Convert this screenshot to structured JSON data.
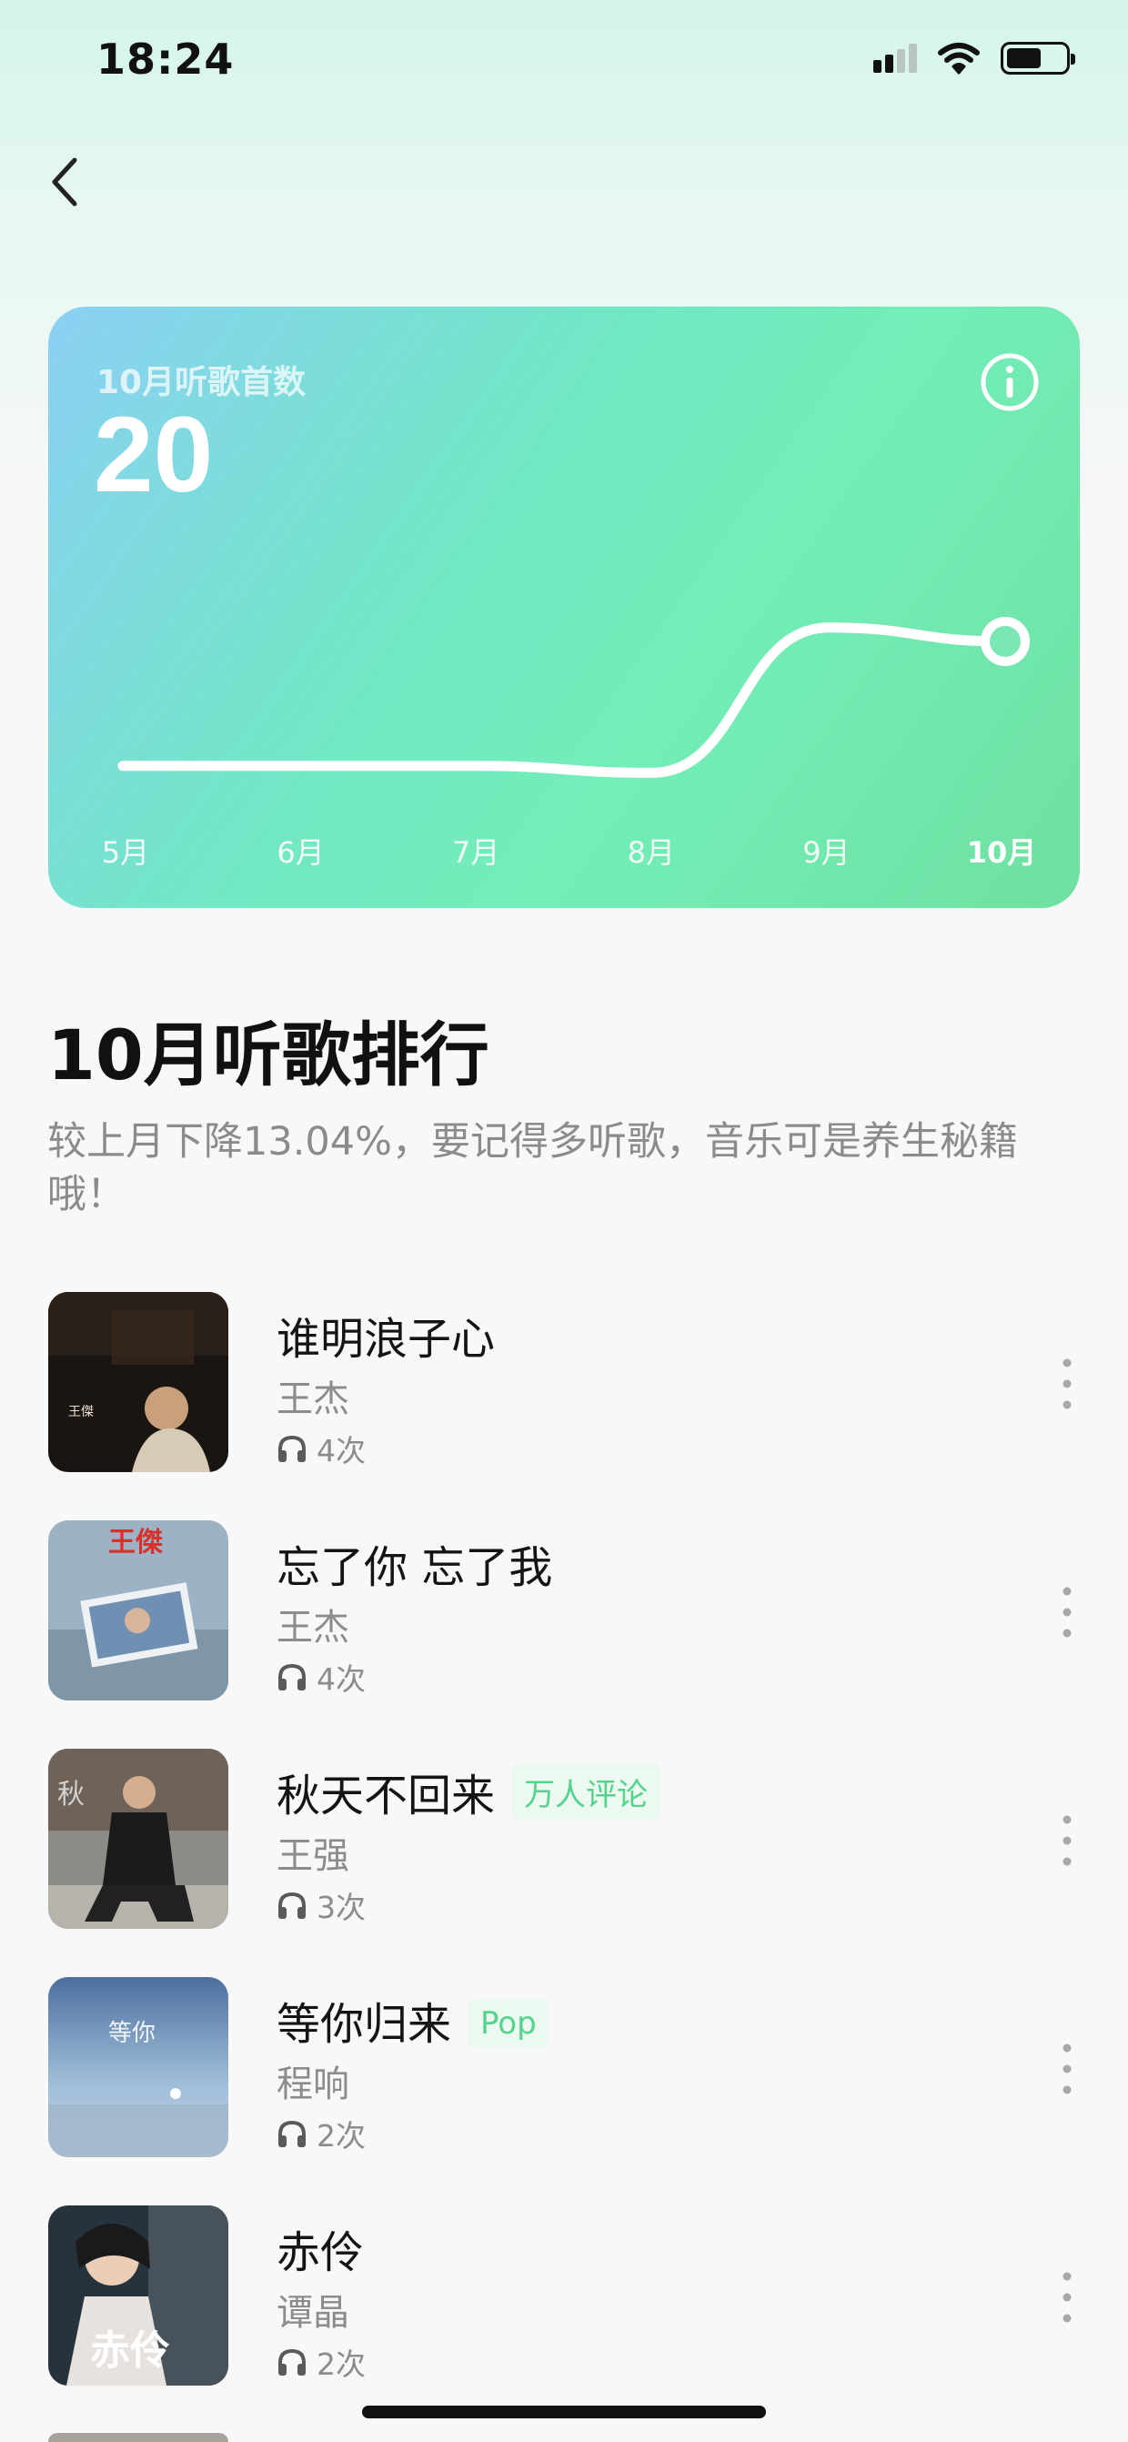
{
  "status_bar": {
    "time": "18:24"
  },
  "card": {
    "label": "10月听歌首数",
    "value": "20",
    "months": [
      "5月",
      "6月",
      "7月",
      "8月",
      "9月",
      "10月"
    ],
    "active_month": "10月"
  },
  "chart_data": {
    "type": "line",
    "categories": [
      "5月",
      "6月",
      "7月",
      "8月",
      "9月",
      "10月"
    ],
    "values": [
      2,
      2,
      2,
      1,
      22,
      20
    ],
    "highlight": "10月",
    "title": "",
    "xlabel": "",
    "ylabel": "",
    "ylim": [
      0,
      25
    ]
  },
  "ranking": {
    "title": "10月听歌排行",
    "subtitle": "较上月下降13.04%，要记得多听歌，音乐可是养生秘籍哦！"
  },
  "songs": [
    {
      "title": "谁明浪子心",
      "artist": "王杰",
      "plays": "4次",
      "tag": ""
    },
    {
      "title": "忘了你 忘了我",
      "artist": "王杰",
      "plays": "4次",
      "tag": ""
    },
    {
      "title": "秋天不回来",
      "artist": "王强",
      "plays": "3次",
      "tag": "万人评论"
    },
    {
      "title": "等你归来",
      "artist": "程响",
      "plays": "2次",
      "tag": "Pop"
    },
    {
      "title": "赤伶",
      "artist": "谭晶",
      "plays": "2次",
      "tag": ""
    }
  ],
  "covers": [
    {
      "text": "王傑"
    },
    {
      "text": "王傑"
    },
    {
      "text": ""
    },
    {
      "text": ""
    },
    {
      "text": "赤伶"
    }
  ],
  "colors": {
    "accent": "#55d38d",
    "card_start": "#8bd0f4",
    "card_end": "#6fe0a0"
  }
}
